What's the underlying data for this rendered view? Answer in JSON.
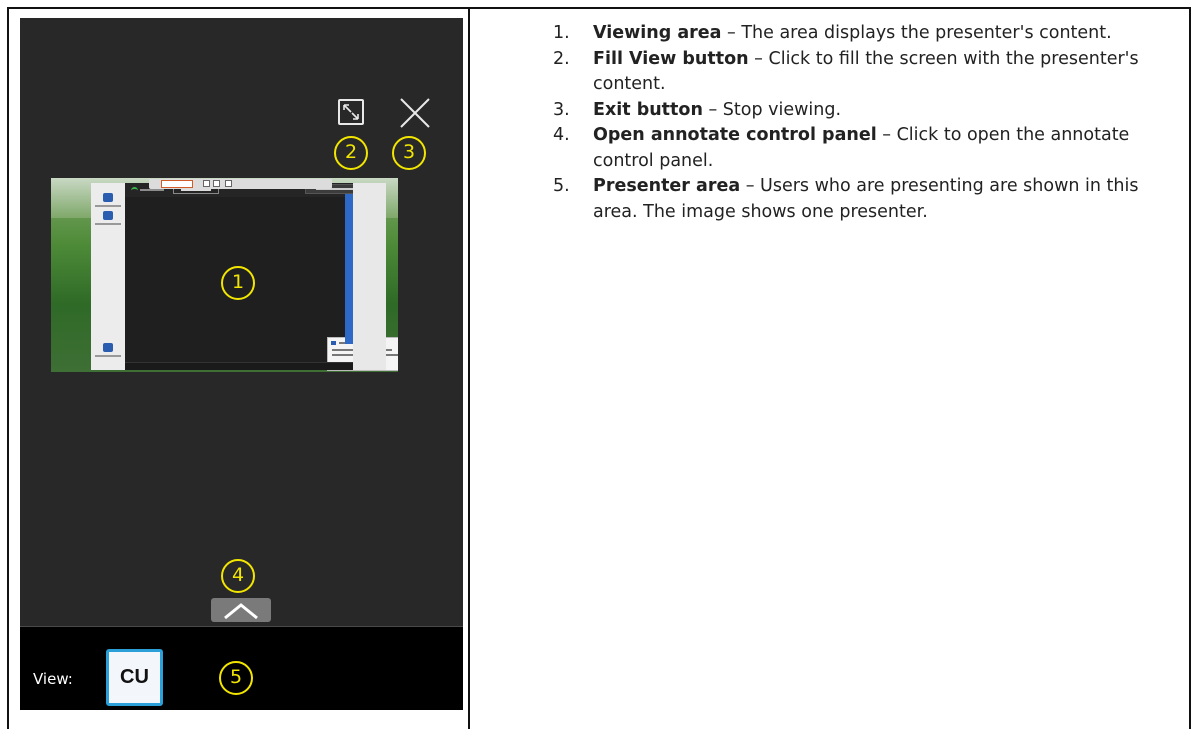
{
  "phone": {
    "callouts": [
      "1",
      "2",
      "3",
      "4",
      "5"
    ],
    "bottom_bar": {
      "view_label": "View:",
      "presenter_tile": "CU"
    },
    "icons": {
      "fill_view": "expand-arrows-icon",
      "exit": "close-x-icon",
      "annotate": "chevron-up-icon"
    },
    "colors": {
      "screen_background": "#282828",
      "bottom_bar_background": "#000000",
      "callout_yellow": "#f2e600",
      "tile_border": "#2a9fd8"
    },
    "viewing_area": {
      "shared_screen_content": "Presenter's shared desktop with a Stop Presenting toolbar, Disconnect and Stop Presenting buttons, a sidebar, and a sharing notification, over a green hills wallpaper"
    }
  },
  "descriptions": [
    {
      "num": "1.",
      "term": "Viewing area",
      "text": " – The area displays the presenter's content."
    },
    {
      "num": "2.",
      "term": "Fill View button",
      "text": " – Click to fill the screen with the presenter's content."
    },
    {
      "num": "3.",
      "term": "Exit button",
      "text": " – Stop viewing."
    },
    {
      "num": "4.",
      "term": "Open annotate control panel",
      "text": " – Click to open the annotate control panel."
    },
    {
      "num": "5.",
      "term": "Presenter area",
      "text": " – Users who are presenting are shown in this area. The image shows one presenter."
    }
  ]
}
